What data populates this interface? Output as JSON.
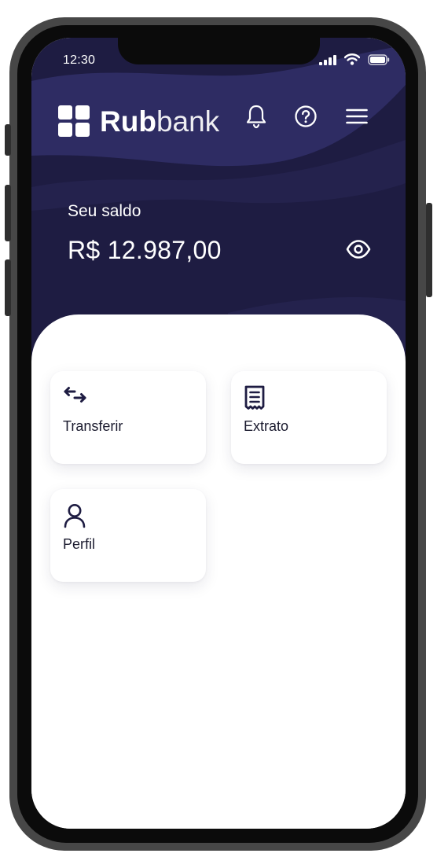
{
  "status_bar": {
    "time": "12:30"
  },
  "brand": {
    "bold": "Rub",
    "light": "bank"
  },
  "balance": {
    "label": "Seu saldo",
    "value": "R$ 12.987,00"
  },
  "actions": [
    {
      "label": "Transferir",
      "icon": "transfer-arrows-icon"
    },
    {
      "label": "Extrato",
      "icon": "receipt-icon"
    },
    {
      "label": "Perfil",
      "icon": "user-icon"
    }
  ],
  "colors": {
    "primary": "#1e1c42",
    "wave": "#2e2c63",
    "surface": "#ffffff"
  }
}
